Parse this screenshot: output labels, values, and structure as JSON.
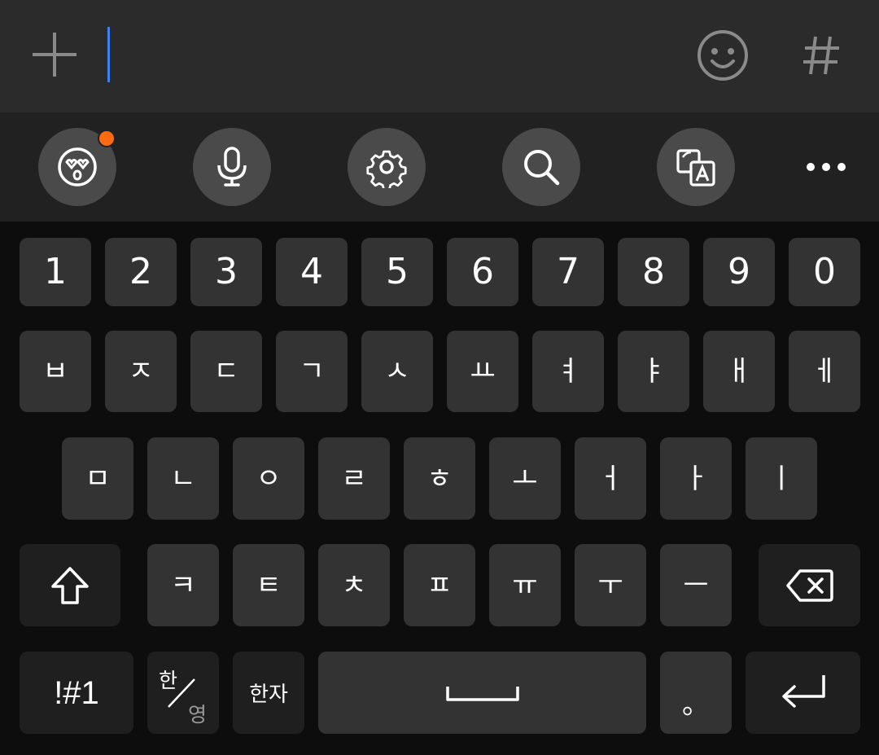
{
  "input": {
    "value": "",
    "add_icon": "plus-icon",
    "emoji_icon": "smiley-icon",
    "tag_icon": "hash-icon"
  },
  "toolbar": {
    "items": [
      {
        "name": "emoji-sticker",
        "icon": "heart-eyes-face-icon",
        "badge": true
      },
      {
        "name": "voice-input",
        "icon": "microphone-icon"
      },
      {
        "name": "settings",
        "icon": "gear-icon"
      },
      {
        "name": "search",
        "icon": "search-icon"
      },
      {
        "name": "translate",
        "icon": "translate-icon"
      },
      {
        "name": "more",
        "icon": "more-dots-icon"
      }
    ],
    "badge_color": "#ff6a13"
  },
  "keyboard": {
    "row_numbers": [
      "1",
      "2",
      "3",
      "4",
      "5",
      "6",
      "7",
      "8",
      "9",
      "0"
    ],
    "row_1": [
      "ㅂ",
      "ㅈ",
      "ㄷ",
      "ㄱ",
      "ㅅ",
      "ㅛ",
      "ㅕ",
      "ㅑ",
      "ㅐ",
      "ㅔ"
    ],
    "row_2": [
      "ㅁ",
      "ㄴ",
      "ㅇ",
      "ㄹ",
      "ㅎ",
      "ㅗ",
      "ㅓ",
      "ㅏ",
      "ㅣ"
    ],
    "row_3": [
      "ㅋ",
      "ㅌ",
      "ㅊ",
      "ㅍ",
      "ㅠ",
      "ㅜ",
      "ㅡ"
    ],
    "shift_icon": "shift-arrow-icon",
    "backspace_icon": "backspace-icon",
    "symbols_label": "!#1",
    "lang_top": "한",
    "lang_bottom": "영",
    "hanja_label": "한자",
    "space_icon": "space-bracket-icon",
    "period_label": "。",
    "enter_icon": "enter-arrow-icon"
  },
  "colors": {
    "top_bar": "#2b2b2b",
    "toolbar": "#212121",
    "keyboard_bg": "#0d0d0d",
    "key": "#333333",
    "function_key": "#1f1f1f",
    "cursor": "#3b82f6"
  }
}
